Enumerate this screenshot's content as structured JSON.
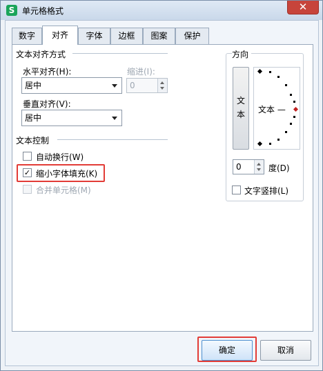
{
  "window": {
    "title": "单元格格式",
    "app_icon_letter": "S",
    "close_glyph": "✕"
  },
  "tabs": [
    {
      "label": "数字",
      "active": false
    },
    {
      "label": "对齐",
      "active": true
    },
    {
      "label": "字体",
      "active": false
    },
    {
      "label": "边框",
      "active": false
    },
    {
      "label": "图案",
      "active": false
    },
    {
      "label": "保护",
      "active": false
    }
  ],
  "alignment": {
    "group_title": "文本对齐方式",
    "horizontal_label": "水平对齐(H):",
    "horizontal_value": "居中",
    "indent_label": "缩进(I):",
    "indent_value": "0",
    "vertical_label": "垂直对齐(V):",
    "vertical_value": "居中"
  },
  "text_control": {
    "group_title": "文本控制",
    "wrap_label": "自动换行(W)",
    "wrap_checked": false,
    "shrink_label": "缩小字体填充(K)",
    "shrink_checked": true,
    "merge_label": "合并单元格(M)",
    "merge_checked": false,
    "merge_disabled": true
  },
  "orientation": {
    "group_title": "方向",
    "vertical_text_char1": "文",
    "vertical_text_char2": "本",
    "dial_text": "文本 —",
    "degree_value": "0",
    "degree_label": "度(D)",
    "vertical_layout_label": "文字竖排(L)",
    "vertical_layout_checked": false
  },
  "buttons": {
    "ok_label": "确定",
    "cancel_label": "取消"
  },
  "colors": {
    "highlight": "#e23b36",
    "app_icon": "#1aa45a",
    "close_button": "#c7443b"
  }
}
